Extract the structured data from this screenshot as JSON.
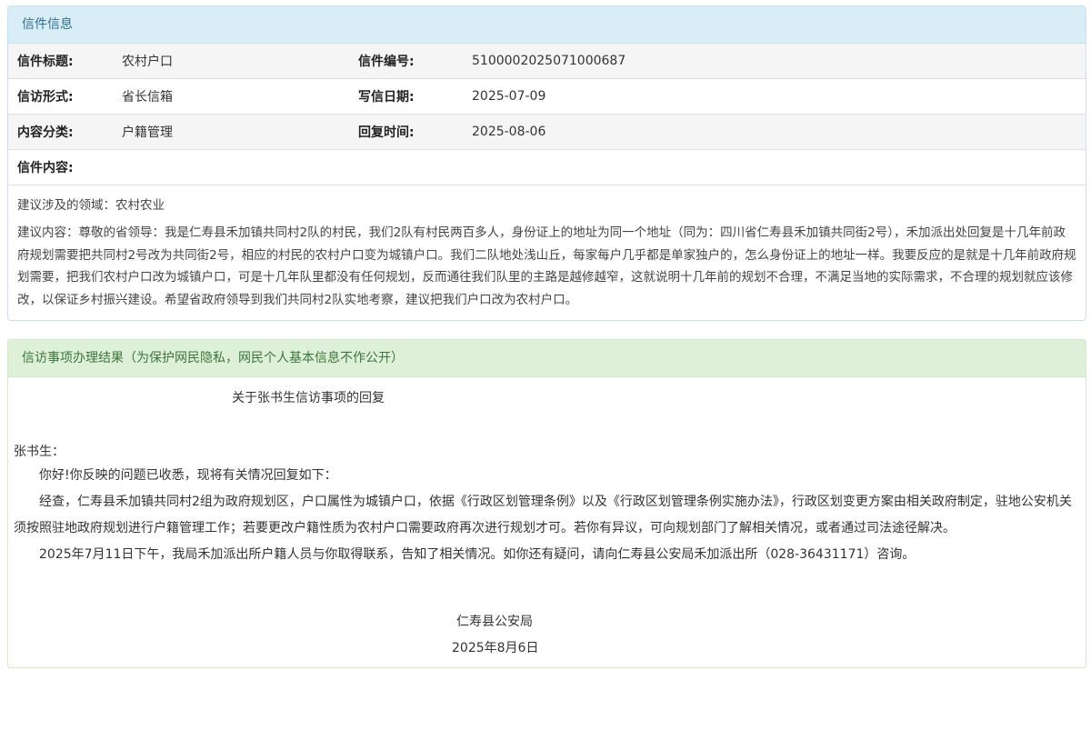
{
  "letter_panel": {
    "heading": "信件信息",
    "rows": [
      {
        "k1": "信件标题:",
        "v1": "农村户口",
        "k2": "信件编号:",
        "v2": "510000202507100068 7"
      },
      {
        "k1": "信访形式:",
        "v1": "省长信箱",
        "k2": "写信日期:",
        "v2": "2025-07-09"
      },
      {
        "k1": "内容分类:",
        "v1": "户籍管理",
        "k2": "回复时间:",
        "v2": "2025-08-06"
      },
      {
        "k1": "信件内容:",
        "v1": "",
        "k2": "",
        "v2": ""
      }
    ],
    "domain_line": "建议涉及的领域：农村农业",
    "content": "建议内容：尊敬的省领导：我是仁寿县禾加镇共同村2队的村民，我们2队有村民两百多人，身份证上的地址为同一个地址（同为：四川省仁寿县禾加镇共同街2号），禾加派出处回复是十几年前政府规划需要把共同村2号改为共同街2号，相应的村民的农村户口变为城镇户口。我们二队地处浅山丘，每家每户几乎都是单家独户的，怎么身份证上的地址一样。我要反应的是就是十几年前政府规划需要，把我们农村户口改为城镇户口，可是十几年队里都没有任何规划，反而通往我们队里的主路是越修越窄，这就说明十几年前的规划不合理，不满足当地的实际需求，不合理的规划就应该修改，以保证乡村振兴建设。希望省政府领导到我们共同村2队实地考察，建议把我们户口改为农村户口。"
  },
  "reply_panel": {
    "heading": "信访事项办理结果（为保护网民隐私，网民个人基本信息不作公开）",
    "title": "关于张书生信访事项的回复",
    "salutation": "张书生：",
    "greeting": "你好!你反映的问题已收悉，现将有关情况回复如下：",
    "para1": "经查，仁寿县禾加镇共同村2组为政府规划区，户口属性为城镇户口，依据《行政区划管理条例》以及《行政区划管理条例实施办法》，行政区划变更方案由相关政府制定，驻地公安机关须按照驻地政府规划进行户籍管理工作；若要更改户籍性质为农村户口需要政府再次进行规划才可。若你有异议，可向规划部门了解相关情况，或者通过司法途径解决。",
    "para2": "2025年7月11日下午，我局禾加派出所户籍人员与你取得联系，告知了相关情况。如你还有疑问，请向仁寿县公安局禾加派出所（028-36431171）咨询。",
    "signature": "仁寿县公安局",
    "date": "2025年8月6日"
  }
}
